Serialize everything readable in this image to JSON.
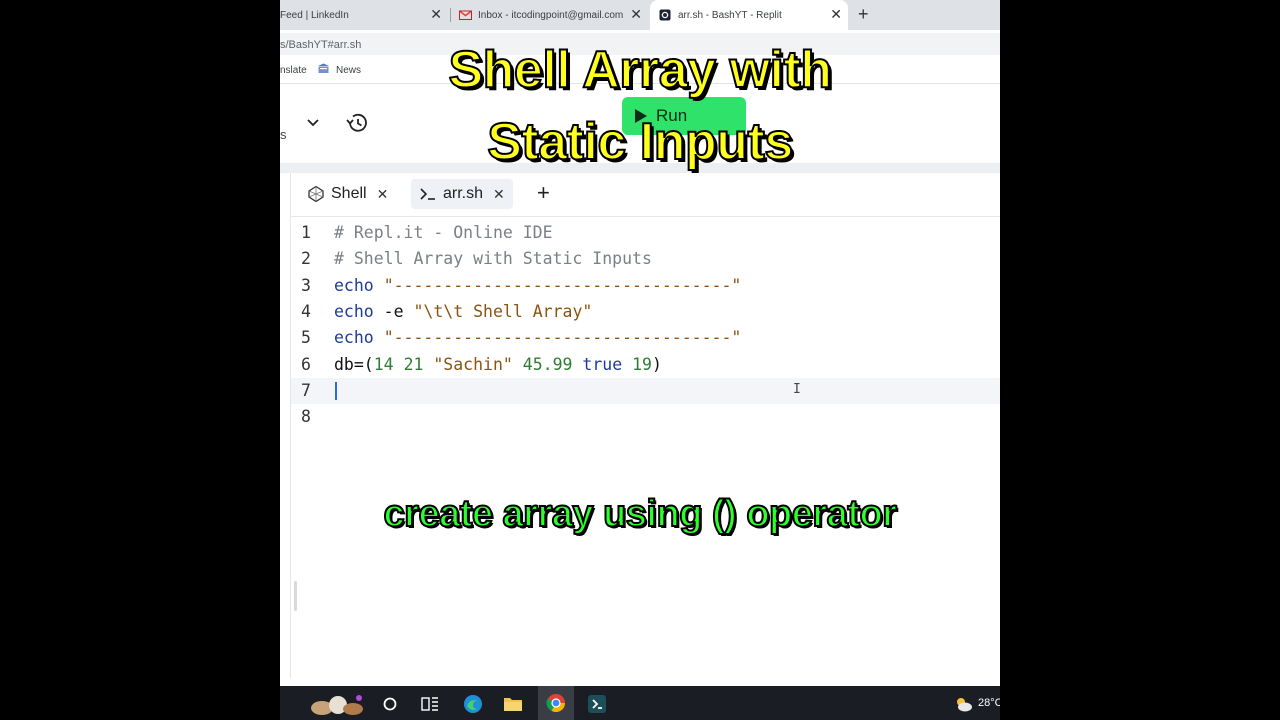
{
  "browser": {
    "tabs": [
      {
        "title": "Feed | LinkedIn",
        "icon": "linkedin-icon"
      },
      {
        "title": "Inbox - itcodingpoint@gmail.com",
        "icon": "gmail-icon"
      },
      {
        "title": "arr.sh - BashYT - Replit",
        "icon": "replit-icon",
        "active": true
      }
    ],
    "address": "s/BashYT#arr.sh",
    "bookmarks": {
      "translate": "nslate",
      "news": "News"
    }
  },
  "replit": {
    "header_fragment": "s",
    "run_label": "Run",
    "accent": "#2fe36a"
  },
  "editor": {
    "tabs": [
      {
        "label": "Shell",
        "icon": "shell-icon"
      },
      {
        "label": "arr.sh",
        "icon": "terminal-prompt-icon",
        "active": true
      }
    ],
    "lines": [
      {
        "num": "1",
        "tokens": [
          {
            "t": "# Repl.it - Online IDE",
            "c": "t-c"
          }
        ]
      },
      {
        "num": "2",
        "tokens": [
          {
            "t": "# Shell Array with Static Inputs",
            "c": "t-c"
          }
        ]
      },
      {
        "num": "3",
        "tokens": [
          {
            "t": "echo",
            "c": "t-k"
          },
          {
            "t": " ",
            "c": "t-d"
          },
          {
            "t": "\"----------------------------------\"",
            "c": "t-s"
          }
        ]
      },
      {
        "num": "4",
        "tokens": [
          {
            "t": "echo",
            "c": "t-k"
          },
          {
            "t": " -e ",
            "c": "t-d"
          },
          {
            "t": "\"\\t\\t Shell Array\"",
            "c": "t-s"
          }
        ]
      },
      {
        "num": "5",
        "tokens": [
          {
            "t": "echo",
            "c": "t-k"
          },
          {
            "t": " ",
            "c": "t-d"
          },
          {
            "t": "\"----------------------------------\"",
            "c": "t-s"
          }
        ]
      },
      {
        "num": "6",
        "tokens": [
          {
            "t": "db=(",
            "c": "t-d"
          },
          {
            "t": "14",
            "c": "t-n"
          },
          {
            "t": " ",
            "c": "t-d"
          },
          {
            "t": "21",
            "c": "t-n"
          },
          {
            "t": " ",
            "c": "t-d"
          },
          {
            "t": "\"Sachin\"",
            "c": "t-s"
          },
          {
            "t": " ",
            "c": "t-d"
          },
          {
            "t": "45.99",
            "c": "t-n"
          },
          {
            "t": " ",
            "c": "t-d"
          },
          {
            "t": "true",
            "c": "t-k"
          },
          {
            "t": " ",
            "c": "t-d"
          },
          {
            "t": "19",
            "c": "t-n"
          },
          {
            "t": ")",
            "c": "t-d"
          }
        ]
      },
      {
        "num": "7",
        "tokens": [],
        "current": true
      },
      {
        "num": "8",
        "tokens": []
      }
    ]
  },
  "taskbar": {
    "icons": [
      "start-icon",
      "search-circle-icon",
      "task-view-icon",
      "edge-icon",
      "file-explorer-icon",
      "chrome-icon",
      "app-icon"
    ],
    "temperature": "28°C"
  },
  "captions": {
    "title_line1": "Shell Array with",
    "title_line2": "Static Inputs",
    "subtitle": "create array using () operator"
  }
}
